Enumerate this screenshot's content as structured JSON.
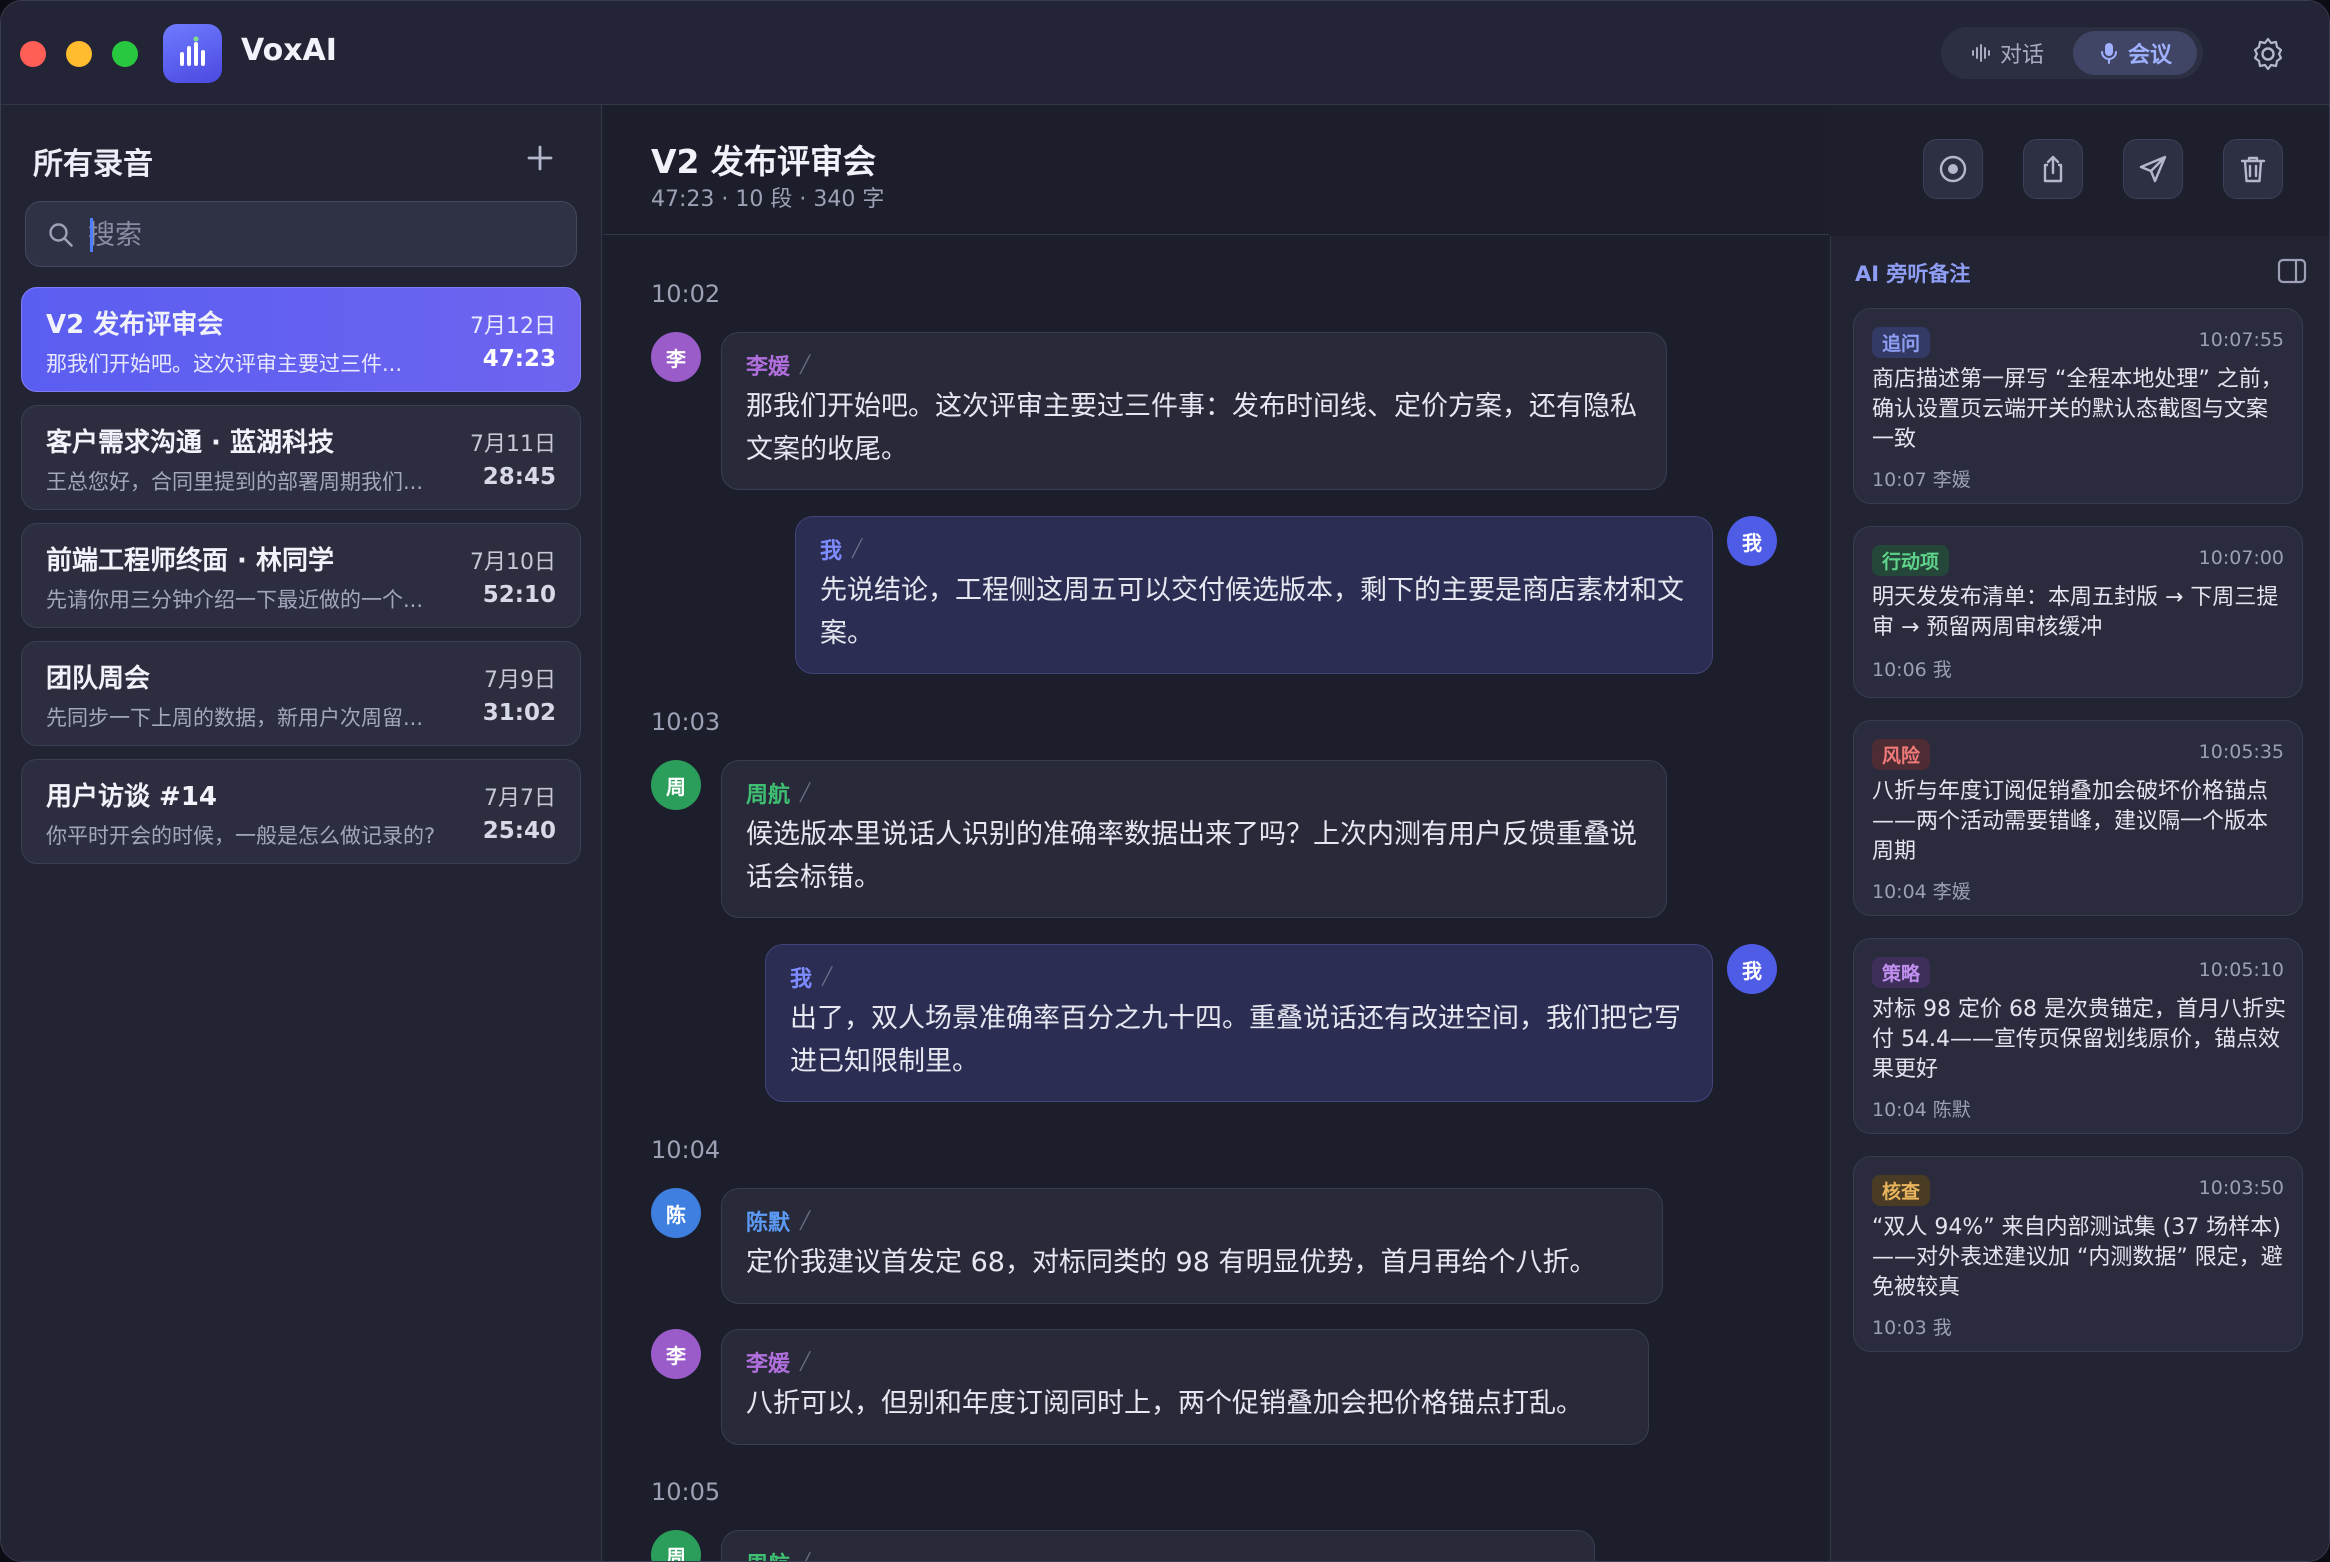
{
  "app": {
    "name": "VoxAI"
  },
  "modes": [
    {
      "label": "对话",
      "active": false
    },
    {
      "label": "会议",
      "active": true
    }
  ],
  "sidebar": {
    "title": "所有录音",
    "search_placeholder": "搜索",
    "recordings": [
      {
        "title": "V2 发布评审会",
        "date": "7月12日",
        "preview": "那我们开始吧。这次评审主要过三件...",
        "duration": "47:23",
        "active": true
      },
      {
        "title": "客户需求沟通 · 蓝湖科技",
        "date": "7月11日",
        "preview": "王总您好，合同里提到的部署周期我们...",
        "duration": "28:45",
        "active": false
      },
      {
        "title": "前端工程师终面 · 林同学",
        "date": "7月10日",
        "preview": "先请你用三分钟介绍一下最近做的一个...",
        "duration": "52:10",
        "active": false
      },
      {
        "title": "团队周会",
        "date": "7月9日",
        "preview": "先同步一下上周的数据，新用户次周留...",
        "duration": "31:02",
        "active": false
      },
      {
        "title": "用户访谈 #14",
        "date": "7月7日",
        "preview": "你平时开会的时候，一般是怎么做记录的?",
        "duration": "25:40",
        "active": false
      }
    ]
  },
  "meeting": {
    "title": "V2 发布评审会",
    "meta": "47:23 · 10 段 · 340 字",
    "time_marks": [
      "10:02",
      "10:03",
      "10:04",
      "10:05"
    ],
    "messages": [
      {
        "avatar": "李",
        "speaker": "李媛",
        "color": "#b06fdc",
        "is_me": false,
        "text": "那我们开始吧。这次评审主要过三件事：发布时间线、定价方案，还有隐私文案的收尾。"
      },
      {
        "avatar": "我",
        "speaker": "我",
        "color": "#5b6cf0",
        "is_me": true,
        "text": "先说结论，工程侧这周五可以交付候选版本，剩下的主要是商店素材和文案。"
      },
      {
        "avatar": "周",
        "speaker": "周航",
        "color": "#2fa862",
        "is_me": false,
        "text": "候选版本里说话人识别的准确率数据出来了吗？上次内测有用户反馈重叠说话会标错。"
      },
      {
        "avatar": "我",
        "speaker": "我",
        "color": "#5b6cf0",
        "is_me": true,
        "text": "出了，双人场景准确率百分之九十四。重叠说话还有改进空间，我们把它写进已知限制里。"
      },
      {
        "avatar": "陈",
        "speaker": "陈默",
        "color": "#4a87e8",
        "is_me": false,
        "text": "定价我建议首发定 68，对标同类的 98 有明显优势，首月再给个八折。"
      },
      {
        "avatar": "李",
        "speaker": "李媛",
        "color": "#b06fdc",
        "is_me": false,
        "text": "八折可以，但别和年度订阅同时上，两个促销叠加会把价格锚点打乱。"
      },
      {
        "avatar": "周",
        "speaker": "周航",
        "color": "#2fa862",
        "is_me": false,
        "text": ""
      }
    ]
  },
  "ai_panel": {
    "title": "AI 旁听备注",
    "notes": [
      {
        "tag": "追问",
        "tag_color": "#8e9ef5",
        "tag_bg": "#343a66",
        "time": "10:07:55",
        "text": "商店描述第一屏写 “全程本地处理” 之前，确认设置页云端开关的默认态截图与文案一致",
        "meta": "10:07 李媛"
      },
      {
        "tag": "行动项",
        "tag_color": "#5fd38a",
        "tag_bg": "#24473a",
        "time": "10:07:00",
        "text": "明天发发布清单：本周五封版 → 下周三提审 → 预留两周审核缓冲",
        "meta": "10:06 我"
      },
      {
        "tag": "风险",
        "tag_color": "#f07a7a",
        "tag_bg": "#4d2c34",
        "time": "10:05:35",
        "text": "八折与年度订阅促销叠加会破坏价格锚点——两个活动需要错峰，建议隔一个版本周期",
        "meta": "10:04 李媛"
      },
      {
        "tag": "策略",
        "tag_color": "#c08ff0",
        "tag_bg": "#3e2f5a",
        "time": "10:05:10",
        "text": "对标 98 定价 68 是次贵锚定，首月八折实付 54.4——宣传页保留划线原价，锚点效果更好",
        "meta": "10:04 陈默"
      },
      {
        "tag": "核查",
        "tag_color": "#e8b45c",
        "tag_bg": "#4a3b24",
        "time": "10:03:50",
        "text": "“双人 94%” 来自内部测试集 (37 场样本)——对外表述建议加 “内测数据” 限定，避免被较真",
        "meta": "10:03 我"
      }
    ]
  }
}
